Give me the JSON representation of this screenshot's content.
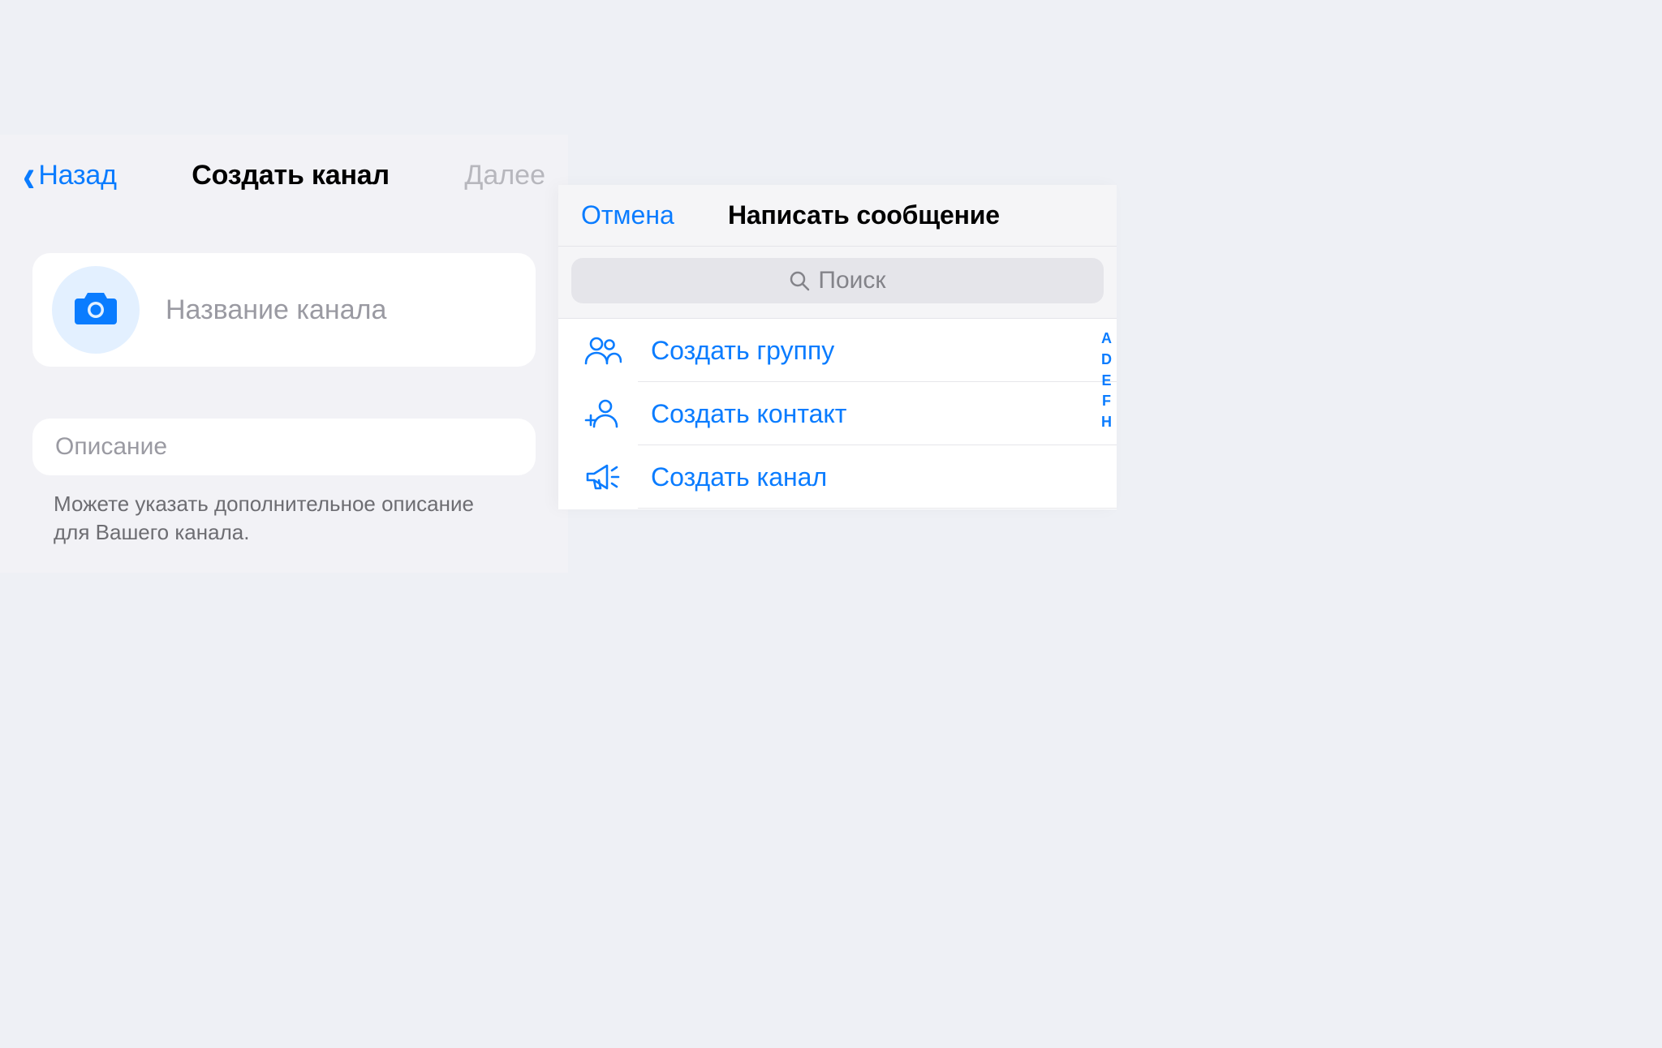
{
  "left": {
    "back_label": "Назад",
    "title": "Создать канал",
    "next_label": "Далее",
    "name_placeholder": "Название канала",
    "desc_placeholder": "Описание",
    "footer_note": "Можете указать дополнительное описание для Вашего канала."
  },
  "right": {
    "cancel_label": "Отмена",
    "title": "Написать сообщение",
    "search_placeholder": "Поиск",
    "options": {
      "group": "Создать группу",
      "contact": "Создать контакт",
      "channel": "Создать канал"
    },
    "index_letters": [
      "A",
      "D",
      "E",
      "F",
      "H"
    ]
  }
}
